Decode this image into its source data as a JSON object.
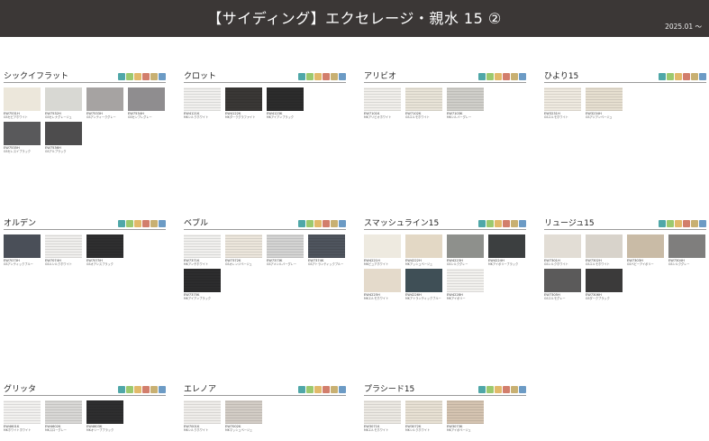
{
  "header": {
    "title": "【サイディング】エクセレージ・親水 15 ②",
    "date": "2025.01 〜"
  },
  "badge_colors": [
    "#4fa7a8",
    "#9cc96e",
    "#e2b96a",
    "#d27e6c",
    "#c8b072",
    "#6c9bc5"
  ],
  "sections": [
    {
      "title": "シックイフラット",
      "swatches": [
        {
          "code": "EW7531H",
          "name": "GSセピアホワイト",
          "color": "#ece7db",
          "lined": false
        },
        {
          "code": "EW7532H",
          "name": "GSセレナグレージュ",
          "color": "#d8d8d3",
          "lined": false
        },
        {
          "code": "EW7533H",
          "name": "GSアンティークグレー",
          "color": "#a6a3a2",
          "lined": false
        },
        {
          "code": "EW7534H",
          "name": "GSセンプレグレー",
          "color": "#8f8d8f",
          "lined": false
        },
        {
          "code": "EW7535H",
          "name": "GSセレスイブラック",
          "color": "#59595b",
          "lined": false
        },
        {
          "code": "EW7536H",
          "name": "GSアルブラック",
          "color": "#4d4c4d",
          "lined": false
        }
      ]
    },
    {
      "title": "クロット",
      "swatches": [
        {
          "code": "EW4121K",
          "name": "MKシルクホワイト",
          "color": "#f1f0ee",
          "lined": true
        },
        {
          "code": "EW4122K",
          "name": "MKダークグラファイト",
          "color": "#3a3836",
          "lined": true
        },
        {
          "code": "EW4123K",
          "name": "MKアイアンブラック",
          "color": "#2c2c2c",
          "lined": true
        }
      ]
    },
    {
      "title": "アリビオ",
      "swatches": [
        {
          "code": "EW7101K",
          "name": "MKアリビオホワイト",
          "color": "#f1efeb",
          "lined": true
        },
        {
          "code": "EW7102K",
          "name": "GSエルモホワイト",
          "color": "#e9e4d8",
          "lined": true
        },
        {
          "code": "EW7103K",
          "name": "MKシルバーグレー",
          "color": "#d0cfca",
          "lined": true
        }
      ]
    },
    {
      "title": "ひより15",
      "swatches": [
        {
          "code": "EW3231H",
          "name": "GSエルモホワイト",
          "color": "#efeae0",
          "lined": true
        },
        {
          "code": "EW3234H",
          "name": "GSアジアンベージュ",
          "color": "#e6dfd0",
          "lined": true
        }
      ]
    },
    {
      "title": "オルデン",
      "swatches": [
        {
          "code": "EW7073H",
          "name": "GSアンティックブルー",
          "color": "#4a4f58",
          "lined": false
        },
        {
          "code": "EW7074H",
          "name": "GSルシルクホワイト",
          "color": "#f0efed",
          "lined": true
        },
        {
          "code": "EW7075H",
          "name": "GSオアシスブラック",
          "color": "#2f2f30",
          "lined": true
        }
      ]
    },
    {
      "title": "ベブル",
      "swatches": [
        {
          "code": "EW7371K",
          "name": "MKアンチホワイト",
          "color": "#f1f0ee",
          "lined": true
        },
        {
          "code": "EW7372K",
          "name": "GSオレンジベージュ",
          "color": "#ece6dc",
          "lined": true
        },
        {
          "code": "EW7373K",
          "name": "GSアメシルバーグレー",
          "color": "#d4d4d3",
          "lined": true
        },
        {
          "code": "EW7374K",
          "name": "GSアトランティックブルー",
          "color": "#4f555e",
          "lined": true
        },
        {
          "code": "EW7375K",
          "name": "MKアイアンブラック",
          "color": "#2d2d2e",
          "lined": true
        }
      ]
    },
    {
      "title": "スマッシュライン15",
      "swatches": [
        {
          "code": "EW4221H",
          "name": "MKピュアホワイト",
          "color": "#eeeae0",
          "lined": false
        },
        {
          "code": "EW4222H",
          "name": "MKアッシュベージュ",
          "color": "#e3d8c5",
          "lined": false
        },
        {
          "code": "EW4223H",
          "name": "GSシルクグレー",
          "color": "#8e908c",
          "lined": false
        },
        {
          "code": "EW4224H",
          "name": "MKアイボリーブラック",
          "color": "#3c3f40",
          "lined": false
        },
        {
          "code": "EW4225H",
          "name": "MKエルモホワイト",
          "color": "#e4dacb",
          "lined": false
        },
        {
          "code": "EW4226H",
          "name": "MKアトランティックブルー",
          "color": "#3f4f56",
          "lined": false
        },
        {
          "code": "EW4228H",
          "name": "MKアイボリー",
          "color": "#f2f1ee",
          "lined": true
        }
      ]
    },
    {
      "title": "リュージュ15",
      "swatches": [
        {
          "code": "EW7301H",
          "name": "GSシルクホワイト",
          "color": "#e2ddd5",
          "lined": false
        },
        {
          "code": "EW7302H",
          "name": "GSエルモホワイト",
          "color": "#d8d3cb",
          "lined": false
        },
        {
          "code": "EW7303H",
          "name": "GSベビーアイボリー",
          "color": "#c9bba6",
          "lined": false
        },
        {
          "code": "EW7304H",
          "name": "GSシルクグレー",
          "color": "#7f7e7d",
          "lined": false
        },
        {
          "code": "EW7305H",
          "name": "GSエルモグレー",
          "color": "#5b5a5a",
          "lined": false
        },
        {
          "code": "EW7306H",
          "name": "GSダークブラック",
          "color": "#3b3a3a",
          "lined": false
        }
      ]
    },
    {
      "title": "グリッタ",
      "swatches": [
        {
          "code": "EW4601K",
          "name": "MKホワイトホワイト",
          "color": "#f2f1ef",
          "lined": true
        },
        {
          "code": "EW4602K",
          "name": "MKスローグレー",
          "color": "#d9d8d6",
          "lined": true
        },
        {
          "code": "EW4603K",
          "name": "MKオリーブブラック",
          "color": "#2e2e2f",
          "lined": true
        }
      ]
    },
    {
      "title": "エレノア",
      "swatches": [
        {
          "code": "EW7001K",
          "name": "MKシルクホワイト",
          "color": "#efedea",
          "lined": true
        },
        {
          "code": "EW7002K",
          "name": "MKマッシュベージュ",
          "color": "#d3cdc6",
          "lined": true
        }
      ]
    },
    {
      "title": "プラシード15",
      "swatches": [
        {
          "code": "EW3071K",
          "name": "MKエルモホワイト",
          "color": "#ece9e3",
          "lined": true
        },
        {
          "code": "EW3072K",
          "name": "MKシルクホワイト",
          "color": "#e8e1d4",
          "lined": true
        },
        {
          "code": "EW3073K",
          "name": "MKアイボベージュ",
          "color": "#d5c4b1",
          "lined": true
        }
      ]
    }
  ]
}
